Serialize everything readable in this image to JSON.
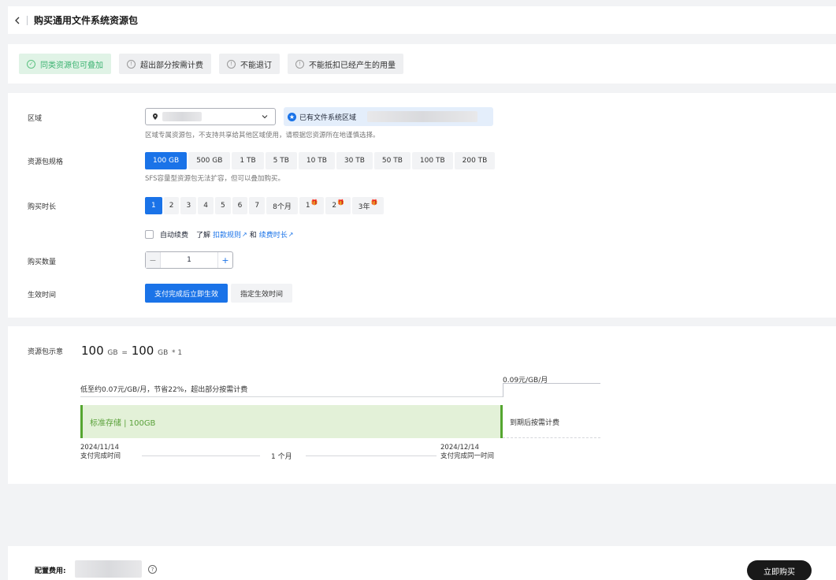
{
  "header": {
    "title": "购买通用文件系统资源包"
  },
  "tags": [
    {
      "label": "同类资源包可叠加",
      "icon": "check-circle-icon",
      "status": "ok"
    },
    {
      "label": "超出部分按需计费",
      "icon": "info-circle-icon",
      "status": "info"
    },
    {
      "label": "不能退订",
      "icon": "info-circle-icon",
      "status": "info"
    },
    {
      "label": "不能抵扣已经产生的用量",
      "icon": "info-circle-icon",
      "status": "info"
    }
  ],
  "region": {
    "label": "区域",
    "tip": "已有文件系统区域",
    "hint": "区域专属资源包，不支持共享给其他区域使用，请根据您资源所在地谨慎选择。"
  },
  "spec": {
    "label": "资源包规格",
    "options": [
      "100 GB",
      "500 GB",
      "1 TB",
      "5 TB",
      "10 TB",
      "30 TB",
      "50 TB",
      "100 TB",
      "200 TB"
    ],
    "selected": "100 GB",
    "hint": "SFS容量型资源包无法扩容，但可以叠加购买。"
  },
  "duration": {
    "label": "购买时长",
    "options": [
      "1",
      "2",
      "3",
      "4",
      "5",
      "6",
      "7",
      "8个月",
      "1",
      "2",
      "3年"
    ],
    "selected": "1",
    "auto_renew_label": "自动续费",
    "learn_prefix": "了解",
    "link_rules": "扣款规则",
    "and_text": "和",
    "link_renew": "续费时长"
  },
  "quantity": {
    "label": "购买数量",
    "value": "1",
    "minus": "−",
    "plus": "+"
  },
  "effective": {
    "label": "生效时间",
    "options": [
      "支付完成后立即生效",
      "指定生效时间"
    ],
    "selected": "支付完成后立即生效"
  },
  "diagram": {
    "label": "资源包示意",
    "formula": {
      "a": "100",
      "a_unit": "GB",
      "eq": "=",
      "b": "100",
      "b_unit": "GB",
      "mult": "* 1"
    },
    "low_note": "低至约0.07元/GB/月，节省22%，超出部分按需计费",
    "high_price": "0.09元/GB/月",
    "bar_label": "标准存储 | 100GB",
    "after_expire": "到期后按需计费",
    "start_date": "2024/11/14",
    "start_label": "支付完成时间",
    "mid_label": "1 个月",
    "end_date": "2024/12/14",
    "end_label": "支付完成同一时间"
  },
  "footer": {
    "fee_label": "配置费用:",
    "buy_label": "立即购买"
  }
}
